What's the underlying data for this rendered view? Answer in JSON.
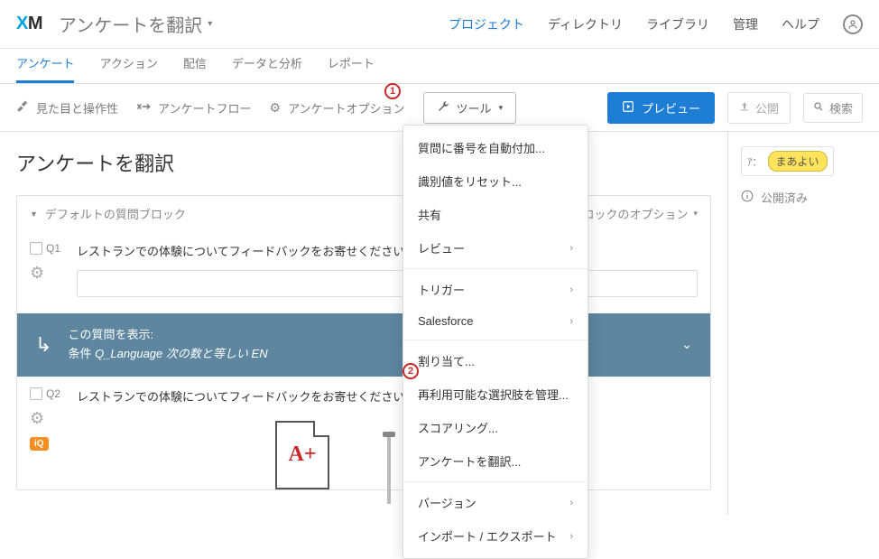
{
  "topbar": {
    "logo_x": "X",
    "logo_m": "M",
    "title": "アンケートを翻訳",
    "links": [
      "プロジェクト",
      "ディレクトリ",
      "ライブラリ",
      "管理",
      "ヘルプ"
    ]
  },
  "tabs": [
    "アンケート",
    "アクション",
    "配信",
    "データと分析",
    "レポート"
  ],
  "toolbar": {
    "look_feel": "見た目と操作性",
    "flow": "アンケートフロー",
    "options": "アンケートオプション",
    "tools": "ツール",
    "preview": "プレビュー",
    "publish": "公開",
    "search": "検索"
  },
  "canvas": {
    "heading": "アンケートを翻訳",
    "block_name": "デフォルトの質問ブロック",
    "block_options": "ブロックのオプション",
    "q1_num": "Q1",
    "q1_text": "レストランでの体験についてフィードバックをお寄せください！",
    "q2_num": "Q2",
    "q2_text": "レストランでの体験についてフィードバックをお寄せください！",
    "iq_label": "iQ",
    "grade": "A+",
    "logic_head": "この質問を表示:",
    "logic_body_prefix": "条件",
    "logic_body_field": "Q_Language",
    "logic_body_mid": "次の数と等しい",
    "logic_body_val": "EN"
  },
  "rightside": {
    "score_prefix": "ｱ：",
    "score_badge": "まあよい",
    "status": "公開済み"
  },
  "dropdown": {
    "items": [
      {
        "label": "質問に番号を自動付加...",
        "sub": false
      },
      {
        "label": "識別値をリセット...",
        "sub": false
      },
      {
        "label": "共有",
        "sub": false
      },
      {
        "label": "レビュー",
        "sub": true
      },
      {
        "sep": true
      },
      {
        "label": "トリガー",
        "sub": true
      },
      {
        "label": "Salesforce",
        "sub": true
      },
      {
        "sep": true
      },
      {
        "label": "割り当て...",
        "sub": false
      },
      {
        "label": "再利用可能な選択肢を管理...",
        "sub": false
      },
      {
        "label": "スコアリング...",
        "sub": false
      },
      {
        "label": "アンケートを翻訳...",
        "sub": false
      },
      {
        "sep": true
      },
      {
        "label": "バージョン",
        "sub": true
      },
      {
        "label": "インポート / エクスポート",
        "sub": true
      }
    ]
  },
  "markers": {
    "m1": "1",
    "m2": "2"
  }
}
